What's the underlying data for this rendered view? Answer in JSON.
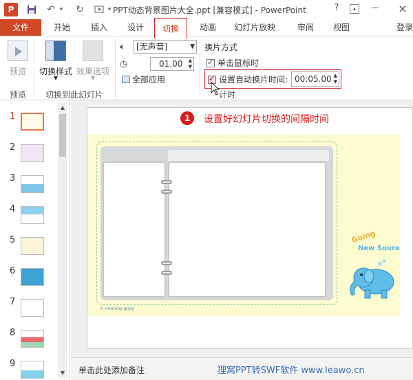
{
  "app": {
    "logo_letter": "P",
    "window_title": "PPT动态背景图片大全.ppt [兼容模式] - PowerPoint",
    "help_label": "?"
  },
  "tabs": [
    {
      "label": "文件"
    },
    {
      "label": "开始"
    },
    {
      "label": "插入"
    },
    {
      "label": "设计"
    },
    {
      "label": "切换"
    },
    {
      "label": "动画"
    },
    {
      "label": "幻灯片放映"
    },
    {
      "label": "审阅"
    },
    {
      "label": "视图"
    },
    {
      "label": "登录"
    }
  ],
  "ribbon": {
    "preview": {
      "label": "预览",
      "group_label": "预览"
    },
    "transition_style": {
      "label": "切换样式"
    },
    "effect_options": {
      "label": "效果选项"
    },
    "transition_group_label": "切换到此幻灯片",
    "sound": {
      "value": "[无声音]"
    },
    "duration": {
      "value": "01.00"
    },
    "apply_all": {
      "label": "全部应用"
    },
    "advance": {
      "title": "换片方式",
      "on_click": {
        "label": "单击鼠标时",
        "checked": true
      },
      "after": {
        "label": "设置自动换片时间:",
        "checked": true,
        "value": "00:05.00"
      }
    },
    "timing_group_label": "计时"
  },
  "slides": [
    {
      "num": "1"
    },
    {
      "num": "2"
    },
    {
      "num": "3"
    },
    {
      "num": "4"
    },
    {
      "num": "5"
    },
    {
      "num": "6"
    },
    {
      "num": "7"
    },
    {
      "num": "8"
    },
    {
      "num": "9"
    }
  ],
  "annotation": {
    "step": "1",
    "text": "设置好幻灯片切换的间隔时间"
  },
  "slide_content": {
    "brand": "© morning glory",
    "going": "Going",
    "new_soure": "New Soure"
  },
  "notes_placeholder": "单击此处添加备注",
  "watermark": "狸窝PPT转SWF软件 www.leawo.cn",
  "colors": {
    "accent": "#d24726",
    "highlight_red": "#cc2a2a",
    "annotation_red": "#d91c1c"
  }
}
